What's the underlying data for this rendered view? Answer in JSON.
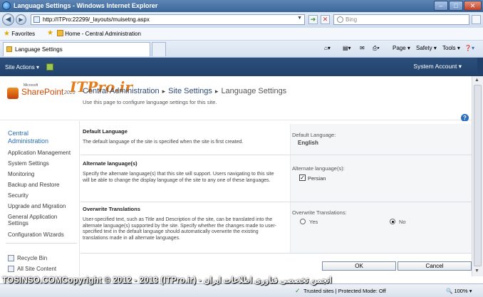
{
  "window": {
    "title": "Language Settings - Windows Internet Explorer"
  },
  "address_bar": {
    "url": "http://ITPro:22299/_layouts/muisetng.aspx",
    "search_placeholder": "Bing"
  },
  "favorites_bar": {
    "favorites_label": "Favorites",
    "link": "Home - Central Administration"
  },
  "tab": {
    "label": "Language Settings"
  },
  "command_bar": {
    "page": "Page",
    "safety": "Safety",
    "tools": "Tools"
  },
  "ribbon": {
    "site_actions": "Site Actions",
    "account": "System Account"
  },
  "header": {
    "logo_ms": "Microsoft",
    "logo_text": "SharePoint",
    "logo_year": "2010",
    "watermark": "ITPro.ir",
    "breadcrumb": [
      "Central Administration",
      "Site Settings",
      "Language Settings"
    ],
    "subtitle": "Use this page to configure language settings for this site."
  },
  "left_nav": {
    "head": "Central Administration",
    "items": [
      "Application Management",
      "System Settings",
      "Monitoring",
      "Backup and Restore",
      "Security",
      "Upgrade and Migration",
      "General Application Settings",
      "Configuration Wizards"
    ],
    "bottom_items": [
      "Recycle Bin",
      "All Site Content"
    ]
  },
  "sections": {
    "default_language": {
      "heading": "Default Language",
      "text": "The default language of the site is specified when the site is first created.",
      "label": "Default Language:",
      "value": "English"
    },
    "alternate_languages": {
      "heading": "Alternate language(s)",
      "text": "Specify the alternate language(s) that this site will support. Users navigating to this site will be able to change the display language of the site to any one of these languages.",
      "label": "Alternate language(s):",
      "option": "Persian",
      "checked": true
    },
    "overwrite_translations": {
      "heading": "Overwrite Translations",
      "text": "User-specified text, such as Title and Description of the site, can be translated into the alternate language(s) supported by the site. Specify whether the changes made to user-specified text in the default language should automatically overwrite the existing translations made in all alternate languages.",
      "label": "Overwrite Translations:",
      "yes": "Yes",
      "no": "No",
      "selected": "No"
    }
  },
  "buttons": {
    "ok": "OK",
    "cancel": "Cancel"
  },
  "status_bar": {
    "zone": "Trusted sites | Protected Mode: Off",
    "zoom": "100%"
  },
  "overlay": {
    "copyright": "TOSINSO.COMCopyright © 2012 - 2013 (ITPro.ir) - انجمن تخصصی فناوری اطلاعات ایران"
  }
}
